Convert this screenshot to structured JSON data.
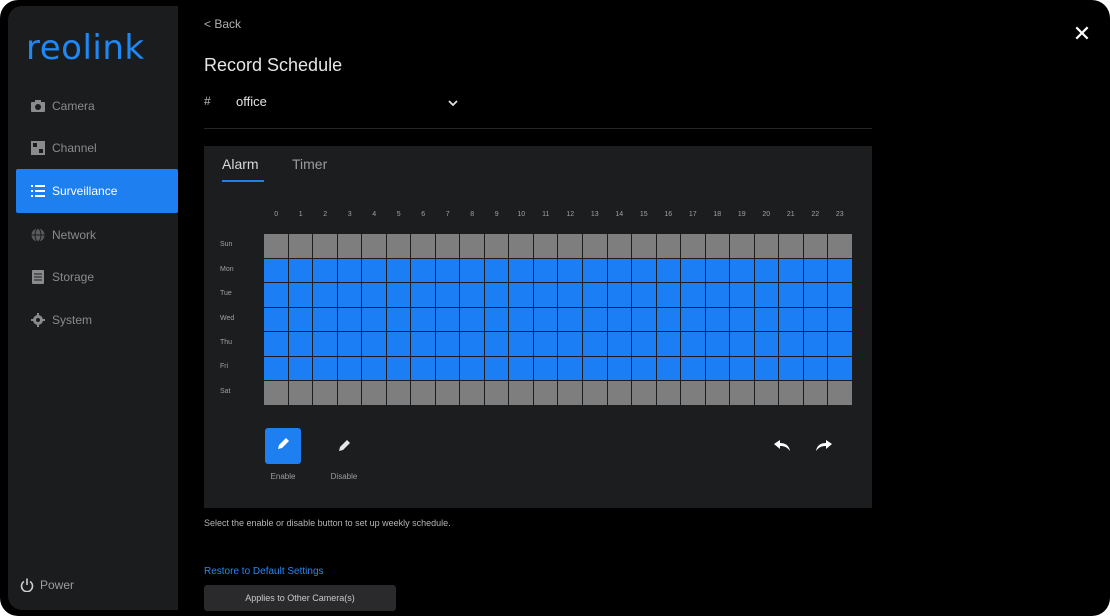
{
  "app": {
    "logo": "reolink"
  },
  "sidebar": {
    "items": [
      {
        "label": "Camera",
        "icon": "camera-icon"
      },
      {
        "label": "Channel",
        "icon": "channel-icon"
      },
      {
        "label": "Surveillance",
        "icon": "list-icon",
        "active": true
      },
      {
        "label": "Network",
        "icon": "globe-icon"
      },
      {
        "label": "Storage",
        "icon": "storage-icon"
      },
      {
        "label": "System",
        "icon": "gear-icon"
      }
    ],
    "power_label": "Power"
  },
  "header": {
    "back_label": "< Back",
    "title": "Record Schedule"
  },
  "channel_select": {
    "number": "#",
    "value": "office"
  },
  "tabs": [
    {
      "label": "Alarm",
      "active": true
    },
    {
      "label": "Timer",
      "active": false
    }
  ],
  "schedule": {
    "hours": [
      "0",
      "1",
      "2",
      "3",
      "4",
      "5",
      "6",
      "7",
      "8",
      "9",
      "10",
      "11",
      "12",
      "13",
      "14",
      "15",
      "16",
      "17",
      "18",
      "19",
      "20",
      "21",
      "22",
      "23"
    ],
    "days": [
      "Sun",
      "Mon",
      "Tue",
      "Wed",
      "Thu",
      "Fri",
      "Sat"
    ],
    "enabled_days": [
      false,
      true,
      true,
      true,
      true,
      true,
      false
    ],
    "enabled_color": "#1b7ef5",
    "disabled_color": "#7e7e7e"
  },
  "tools": {
    "enable_label": "Enable",
    "disable_label": "Disable"
  },
  "hint_text": "Select the enable or disable button to set up weekly schedule.",
  "restore_label": "Restore to Default Settings",
  "apply_label": "Applies to Other Camera(s)"
}
